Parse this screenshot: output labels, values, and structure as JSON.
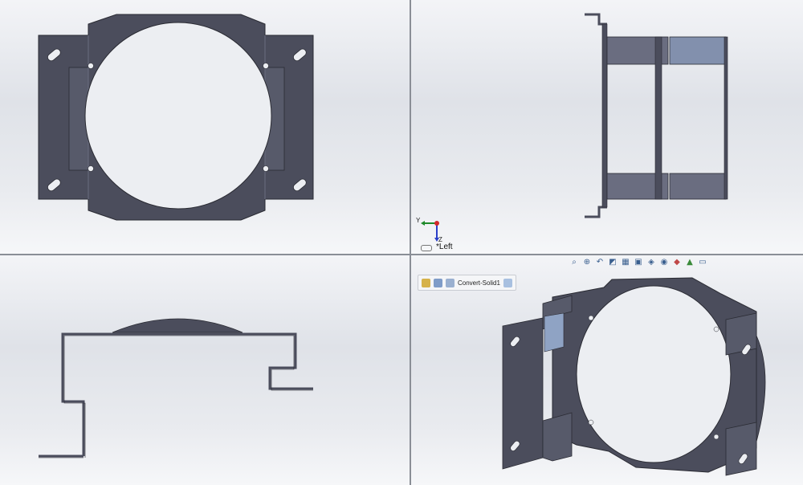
{
  "viewports": {
    "front": {},
    "left": {
      "view_label": "*Left",
      "triad": {
        "y_axis": "Y",
        "z_axis": "Z"
      }
    },
    "top": {},
    "iso": {
      "breadcrumb": {
        "feature_name": "Convert-Solid1"
      },
      "hud_icons": [
        "zoom-to-fit-icon",
        "zoom-area-icon",
        "previous-view-icon",
        "section-view-icon",
        "dynamic-annotation-icon",
        "view-orientation-icon",
        "display-style-icon",
        "hide-show-icon",
        "edit-appearance-icon",
        "apply-scene-icon",
        "view-settings-icon"
      ]
    }
  },
  "colors": {
    "part": "#4b4d5c",
    "part_edge": "#2a2b33",
    "part_light": "#767a8e",
    "selected": "#8fa3c4"
  }
}
